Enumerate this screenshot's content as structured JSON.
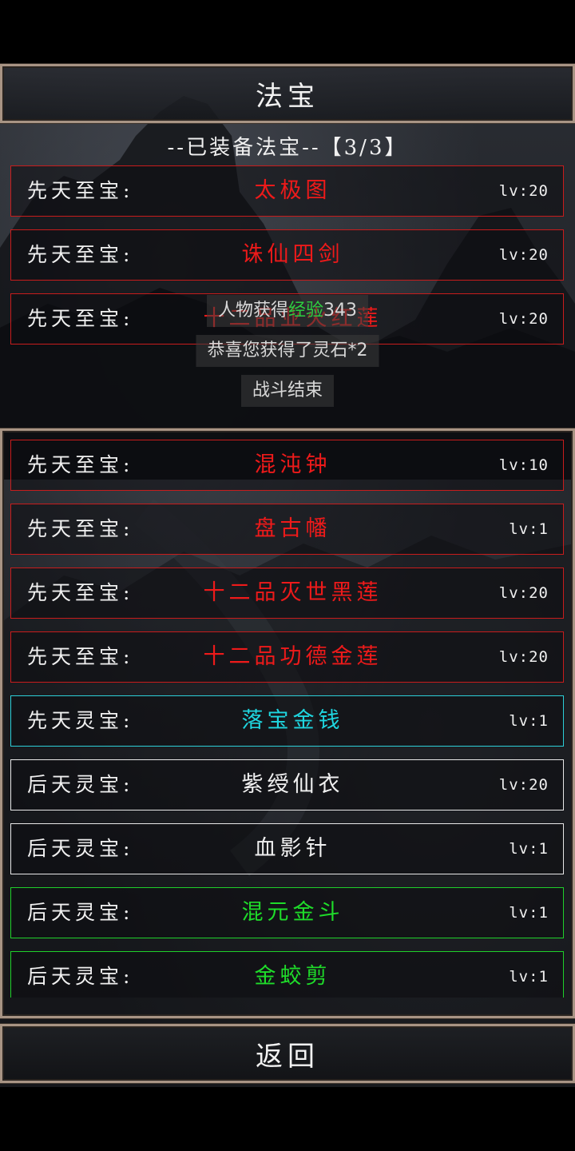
{
  "title": "法宝",
  "equipped_header": "--已装备法宝--【3/3】",
  "equipped": [
    {
      "category": "先天至宝:",
      "name": "太极图",
      "level": "lv:20",
      "color": "#ee1a1a"
    },
    {
      "category": "先天至宝:",
      "name": "诛仙四剑",
      "level": "lv:20",
      "color": "#ee1a1a"
    },
    {
      "category": "先天至宝:",
      "name": "十二品业火红莲",
      "level": "lv:20",
      "color": "#ee1a1a"
    }
  ],
  "toasts": {
    "exp_prefix": "人物获得",
    "exp_word": "经验",
    "exp_value": "343",
    "stone": "恭喜您获得了灵石*2",
    "battle_end": "战斗结束"
  },
  "inventory": [
    {
      "category": "先天至宝:",
      "name": "混沌钟",
      "level": "lv:10",
      "color": "#ee1a1a"
    },
    {
      "category": "先天至宝:",
      "name": "盘古幡",
      "level": "lv:1",
      "color": "#ee1a1a"
    },
    {
      "category": "先天至宝:",
      "name": "十二品灭世黑莲",
      "level": "lv:20",
      "color": "#ee1a1a"
    },
    {
      "category": "先天至宝:",
      "name": "十二品功德金莲",
      "level": "lv:20",
      "color": "#ee1a1a"
    },
    {
      "category": "先天灵宝:",
      "name": "落宝金钱",
      "level": "lv:1",
      "color": "#1fd6e0"
    },
    {
      "category": "后天灵宝:",
      "name": "紫绶仙衣",
      "level": "lv:20",
      "color": "#f0f0f0"
    },
    {
      "category": "后天灵宝:",
      "name": "血影针",
      "level": "lv:1",
      "color": "#f0f0f0"
    },
    {
      "category": "后天灵宝:",
      "name": "混元金斗",
      "level": "lv:1",
      "color": "#1fdc2a"
    },
    {
      "category": "后天灵宝:",
      "name": "金蛟剪",
      "level": "lv:1",
      "color": "#1fdc2a"
    }
  ],
  "back_label": "返回"
}
